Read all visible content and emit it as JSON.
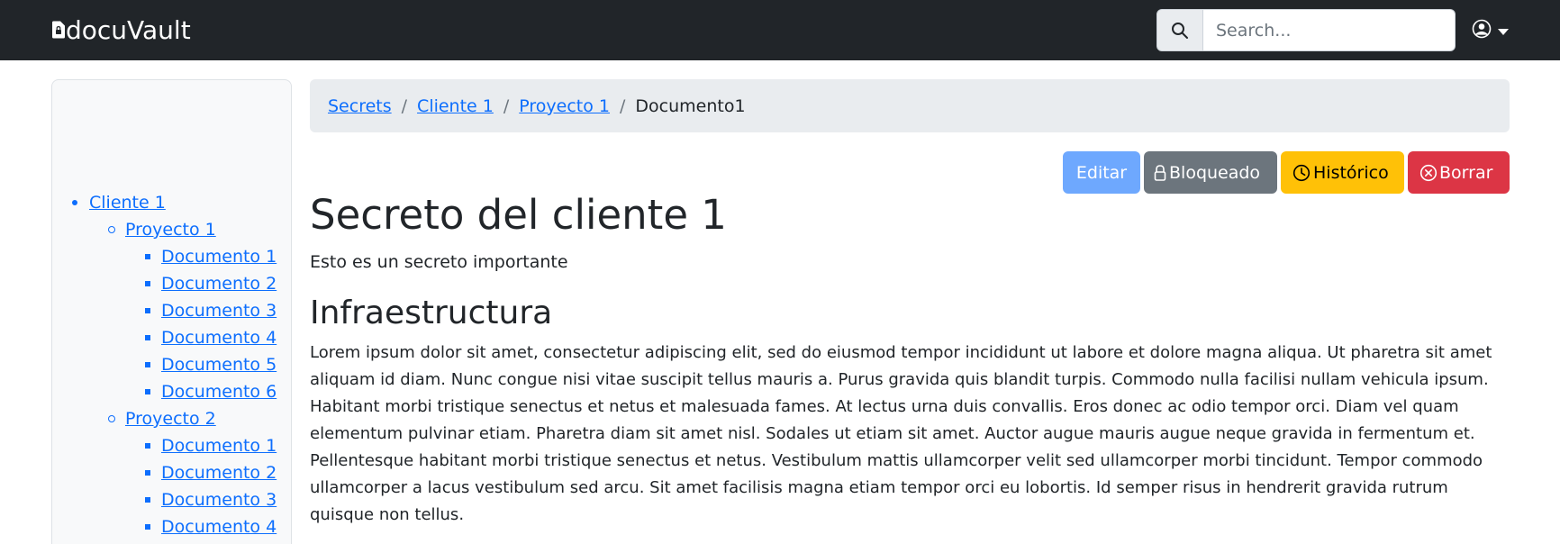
{
  "navbar": {
    "brand": "docuVault",
    "search": {
      "placeholder": "Search...",
      "value": ""
    }
  },
  "breadcrumb": {
    "items": [
      "Secrets",
      "Cliente 1",
      "Proyecto 1"
    ],
    "active": "Documento1"
  },
  "toolbar": {
    "edit_label": "Editar",
    "locked_label": "Bloqueado",
    "history_label": "Histórico",
    "delete_label": "Borrar"
  },
  "sidebar": {
    "clients": [
      {
        "label": "Cliente 1",
        "projects": [
          {
            "label": "Proyecto 1",
            "documents": [
              "Documento 1",
              "Documento 2",
              "Documento 3",
              "Documento 4",
              "Documento 5",
              "Documento 6"
            ]
          },
          {
            "label": "Proyecto 2",
            "documents": [
              "Documento 1",
              "Documento 2",
              "Documento 3",
              "Documento 4"
            ]
          }
        ]
      }
    ]
  },
  "document": {
    "title": "Secreto del cliente 1",
    "subtitle": "Esto es un secreto importante",
    "section_title": "Infraestructura",
    "section_body": "Lorem ipsum dolor sit amet, consectetur adipiscing elit, sed do eiusmod tempor incididunt ut labore et dolore magna aliqua. Ut pharetra sit amet aliquam id diam. Nunc congue nisi vitae suscipit tellus mauris a. Purus gravida quis blandit turpis. Commodo nulla facilisi nullam vehicula ipsum. Habitant morbi tristique senectus et netus et malesuada fames. At lectus urna duis convallis. Eros donec ac odio tempor orci. Diam vel quam elementum pulvinar etiam. Pharetra diam sit amet nisl. Sodales ut etiam sit amet. Auctor augue mauris augue neque gravida in fermentum et. Pellentesque habitant morbi tristique senectus et netus. Vestibulum mattis ullamcorper velit sed ullamcorper morbi tincidunt. Tempor commodo ullamcorper a lacus vestibulum sed arcu. Sit amet facilisis magna etiam tempor orci eu lobortis. Id semper risus in hendrerit gravida rutrum quisque non tellus."
  },
  "colors": {
    "navbar_bg": "#212529",
    "link": "#0d6efd",
    "edit": "#6ea8fe",
    "locked": "#6c757d",
    "history": "#ffc107",
    "delete": "#dc3545"
  },
  "icons": {
    "brand": "file-lock-icon",
    "search": "search-icon",
    "user": "person-circle-icon",
    "caret": "caret-down-icon",
    "locked": "lock-icon",
    "history": "clock-icon",
    "delete": "x-circle-icon"
  }
}
